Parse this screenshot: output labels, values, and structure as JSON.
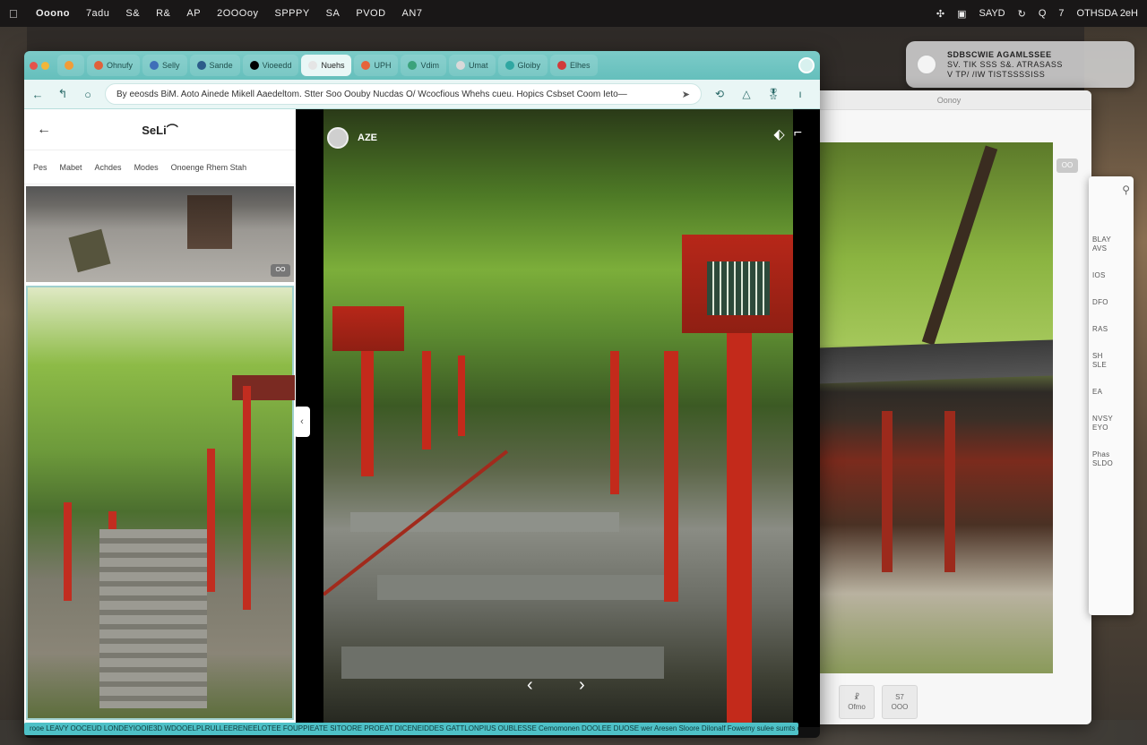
{
  "menubar": {
    "apple": "",
    "items": [
      "Ooono",
      "7adu",
      "S&",
      "R&",
      "AP",
      "2OOOoy",
      "SPPPY",
      "SA",
      "PVOD",
      "AN7"
    ],
    "status": [
      "✣",
      "▣",
      "SAYD",
      "↻",
      "Q",
      "7",
      "OTHSDA 2eH"
    ]
  },
  "notification": {
    "title": "SDBSCWIE   AGAMLSSEE",
    "line1": "SV. TIK SSS    S&. ATRASASS",
    "line2": "V   TP/ /IW   TISTSSSSISS"
  },
  "photos": {
    "title": "Oonoy",
    "badge": "OO",
    "footer": [
      {
        "icon": "☧",
        "label": "Ofmo"
      },
      {
        "icon": "S7",
        "label": "OOO"
      }
    ]
  },
  "info_panel": {
    "items": [
      "BLAY\nAVS",
      "IOS",
      "DFO",
      "RAS",
      "SH\nSLE",
      "EA",
      "NVSY\nEYO",
      "Phas\nSLDO"
    ]
  },
  "browser": {
    "tabs": [
      {
        "label": "",
        "color": "#f29c38"
      },
      {
        "label": "Ohnufy",
        "color": "#e0613b"
      },
      {
        "label": "Selly",
        "color": "#3f6fb8"
      },
      {
        "label": "Sande",
        "color": "#2c5c8a"
      },
      {
        "label": "Vioeedd",
        "color": "#000000"
      },
      {
        "label": "Nuehs",
        "color": "#e5e5e5",
        "active": true
      },
      {
        "label": "UPH",
        "color": "#e6633b"
      },
      {
        "label": "Vdim",
        "color": "#3aa27a"
      },
      {
        "label": "Umat",
        "color": "#d9d9d9"
      },
      {
        "label": "Gloiby",
        "color": "#2fa7a2"
      },
      {
        "label": "Elhes",
        "color": "#d13a3a"
      }
    ],
    "url": "By eeosds BiM. Aoto Ainede Mikell Aaedeltom. Stter Soo Oouby Nucdas O/ Wcocfious Whehs cueu. Hopics Csbset Coom Ieto—",
    "nav": {
      "back": "←",
      "forward": "↰",
      "reload": "○"
    },
    "actions": [
      "⟲",
      "△",
      "🎖",
      "ı"
    ]
  },
  "left_panel": {
    "back": "←",
    "title": "SeLi⌒",
    "filters": [
      "Pes",
      "Mabet",
      "Achdes",
      "Modes",
      "Onoenge Rhem Stah"
    ],
    "badge": "OO"
  },
  "viewer": {
    "logo_text": "AZE",
    "actions": [
      "⬖",
      "⌐"
    ],
    "prev": "‹",
    "next": "›",
    "collapse": "‹"
  },
  "status_strip": "rooe LEAVY OOCEUD LONDEYIOOIE3D WDOOELPLRULLEERENEELOTEE FOUPPIEATE SITOORE PROEAT DICENEIDDES GATTLONPIUS OUBLESSE Cemomonen DOOLEE DUOSE wer Aresen Sloore Dilonalf Fowerny sulee sumts on obtee mscwnest"
}
